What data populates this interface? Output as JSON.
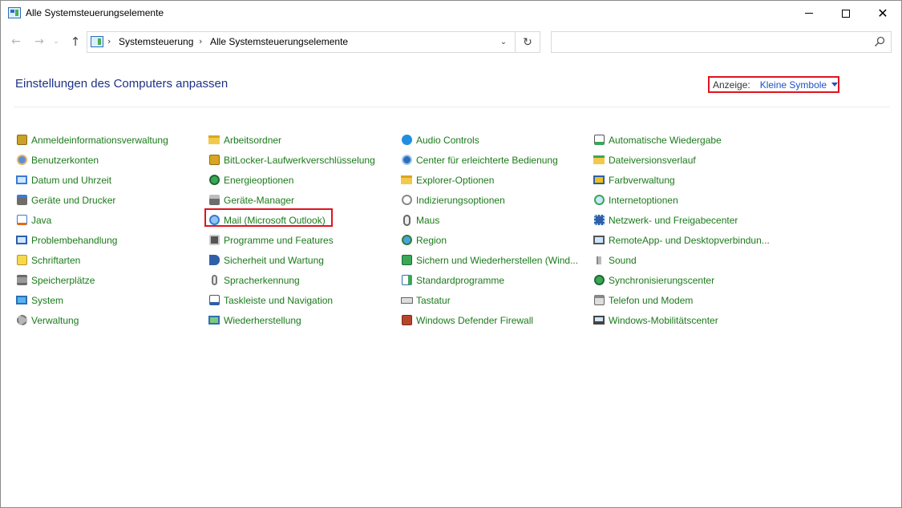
{
  "window": {
    "title": "Alle Systemsteuerungselemente",
    "controls": {
      "minimize": "",
      "maximize": "",
      "close": "✕"
    }
  },
  "nav": {
    "back": "←",
    "forward": "→",
    "recent": "⌄",
    "up": "↑"
  },
  "address": {
    "breadcrumbs": [
      "Systemsteuerung",
      "Alle Systemsteuerungselemente"
    ],
    "separator": "›",
    "dropdown": "⌄",
    "refresh": "↻"
  },
  "search": {
    "placeholder": ""
  },
  "header": {
    "title": "Einstellungen des Computers anpassen",
    "view_label": "Anzeige:",
    "view_value": "Kleine Symbole"
  },
  "columns": [
    [
      {
        "label": "Anmeldeinformationsverwaltung",
        "icon": "credential-vault-icon"
      },
      {
        "label": "Benutzerkonten",
        "icon": "users-icon"
      },
      {
        "label": "Datum und Uhrzeit",
        "icon": "clock-icon"
      },
      {
        "label": "Geräte und Drucker",
        "icon": "printer-icon"
      },
      {
        "label": "Java",
        "icon": "java-icon"
      },
      {
        "label": "Problembehandlung",
        "icon": "troubleshoot-icon"
      },
      {
        "label": "Schriftarten",
        "icon": "font-icon"
      },
      {
        "label": "Speicherplätze",
        "icon": "storage-icon"
      },
      {
        "label": "System",
        "icon": "monitor-icon"
      },
      {
        "label": "Verwaltung",
        "icon": "admin-tools-icon"
      }
    ],
    [
      {
        "label": "Arbeitsordner",
        "icon": "work-folder-icon"
      },
      {
        "label": "BitLocker-Laufwerkverschlüsselung",
        "icon": "bitlocker-icon"
      },
      {
        "label": "Energieoptionen",
        "icon": "power-icon"
      },
      {
        "label": "Geräte-Manager",
        "icon": "device-manager-icon"
      },
      {
        "label": "Mail (Microsoft Outlook)",
        "icon": "mail-icon"
      },
      {
        "label": "Programme und Features",
        "icon": "programs-icon"
      },
      {
        "label": "Sicherheit und Wartung",
        "icon": "flag-icon"
      },
      {
        "label": "Spracherkennung",
        "icon": "microphone-icon"
      },
      {
        "label": "Taskleiste und Navigation",
        "icon": "taskbar-icon"
      },
      {
        "label": "Wiederherstellung",
        "icon": "recovery-icon"
      }
    ],
    [
      {
        "label": "Audio Controls",
        "icon": "hp-icon"
      },
      {
        "label": "Center für erleichterte Bedienung",
        "icon": "accessibility-icon"
      },
      {
        "label": "Explorer-Optionen",
        "icon": "folder-options-icon"
      },
      {
        "label": "Indizierungsoptionen",
        "icon": "indexing-icon"
      },
      {
        "label": "Maus",
        "icon": "mouse-icon"
      },
      {
        "label": "Region",
        "icon": "globe-icon"
      },
      {
        "label": "Sichern und Wiederherstellen (Wind...",
        "icon": "backup-icon"
      },
      {
        "label": "Standardprogramme",
        "icon": "default-programs-icon"
      },
      {
        "label": "Tastatur",
        "icon": "keyboard-icon"
      },
      {
        "label": "Windows Defender Firewall",
        "icon": "firewall-icon"
      }
    ],
    [
      {
        "label": "Automatische Wiedergabe",
        "icon": "autoplay-icon"
      },
      {
        "label": "Dateiversionsverlauf",
        "icon": "file-history-icon"
      },
      {
        "label": "Farbverwaltung",
        "icon": "color-management-icon"
      },
      {
        "label": "Internetoptionen",
        "icon": "internet-options-icon"
      },
      {
        "label": "Netzwerk- und Freigabecenter",
        "icon": "network-icon"
      },
      {
        "label": "RemoteApp- und Desktopverbindun...",
        "icon": "remoteapp-icon"
      },
      {
        "label": "Sound",
        "icon": "speaker-icon"
      },
      {
        "label": "Synchronisierungscenter",
        "icon": "sync-icon"
      },
      {
        "label": "Telefon und Modem",
        "icon": "phone-icon"
      },
      {
        "label": "Windows-Mobilitätscenter",
        "icon": "mobility-icon"
      }
    ]
  ],
  "highlighted_item": "Mail (Microsoft Outlook)",
  "colors": {
    "link": "#1a7a1a",
    "title": "#1e3287",
    "view_value": "#1e50c8",
    "highlight_border": "#e0141e"
  }
}
